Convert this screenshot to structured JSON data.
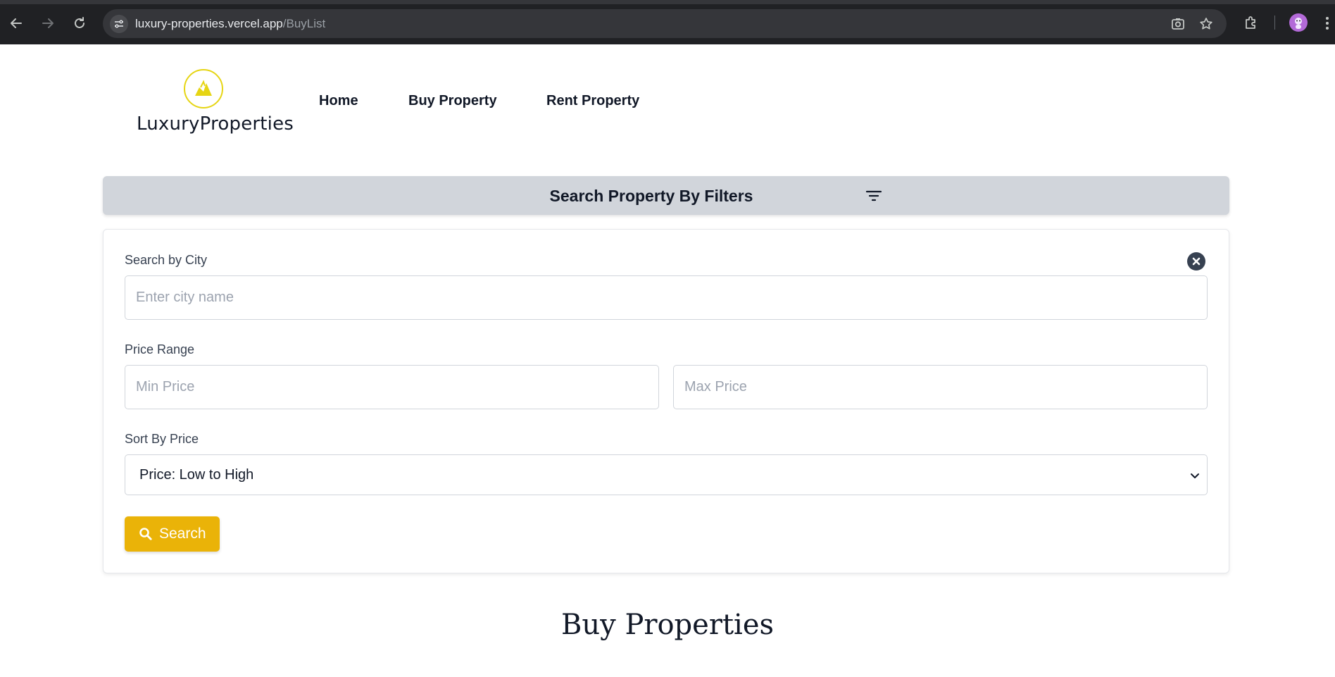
{
  "browser": {
    "url_host": "luxury-properties.vercel.app",
    "url_path": "/BuyList",
    "icons": [
      "back-arrow-icon",
      "forward-arrow-icon",
      "reload-icon",
      "site-info-icon",
      "google-lens-icon",
      "bookmark-star-icon",
      "extensions-icon",
      "profile-avatar-icon",
      "menu-dots-icon"
    ]
  },
  "header": {
    "logo_text": "LuxuryProperties",
    "nav": {
      "home": "Home",
      "buy": "Buy Property",
      "rent": "Rent Property"
    }
  },
  "filters": {
    "title": "Search Property By Filters",
    "city_label": "Search by City",
    "city_placeholder": "Enter city name",
    "city_value": "",
    "price_label": "Price Range",
    "min_placeholder": "Min Price",
    "max_placeholder": "Max Price",
    "sort_label": "Sort By Price",
    "sort_selected": "Price: Low to High",
    "search_label": "Search"
  },
  "main": {
    "section_title": "Buy Properties"
  },
  "colors": {
    "accent": "#eab308",
    "filter_bar": "#d1d5db",
    "logo_ring": "#e6d514"
  }
}
